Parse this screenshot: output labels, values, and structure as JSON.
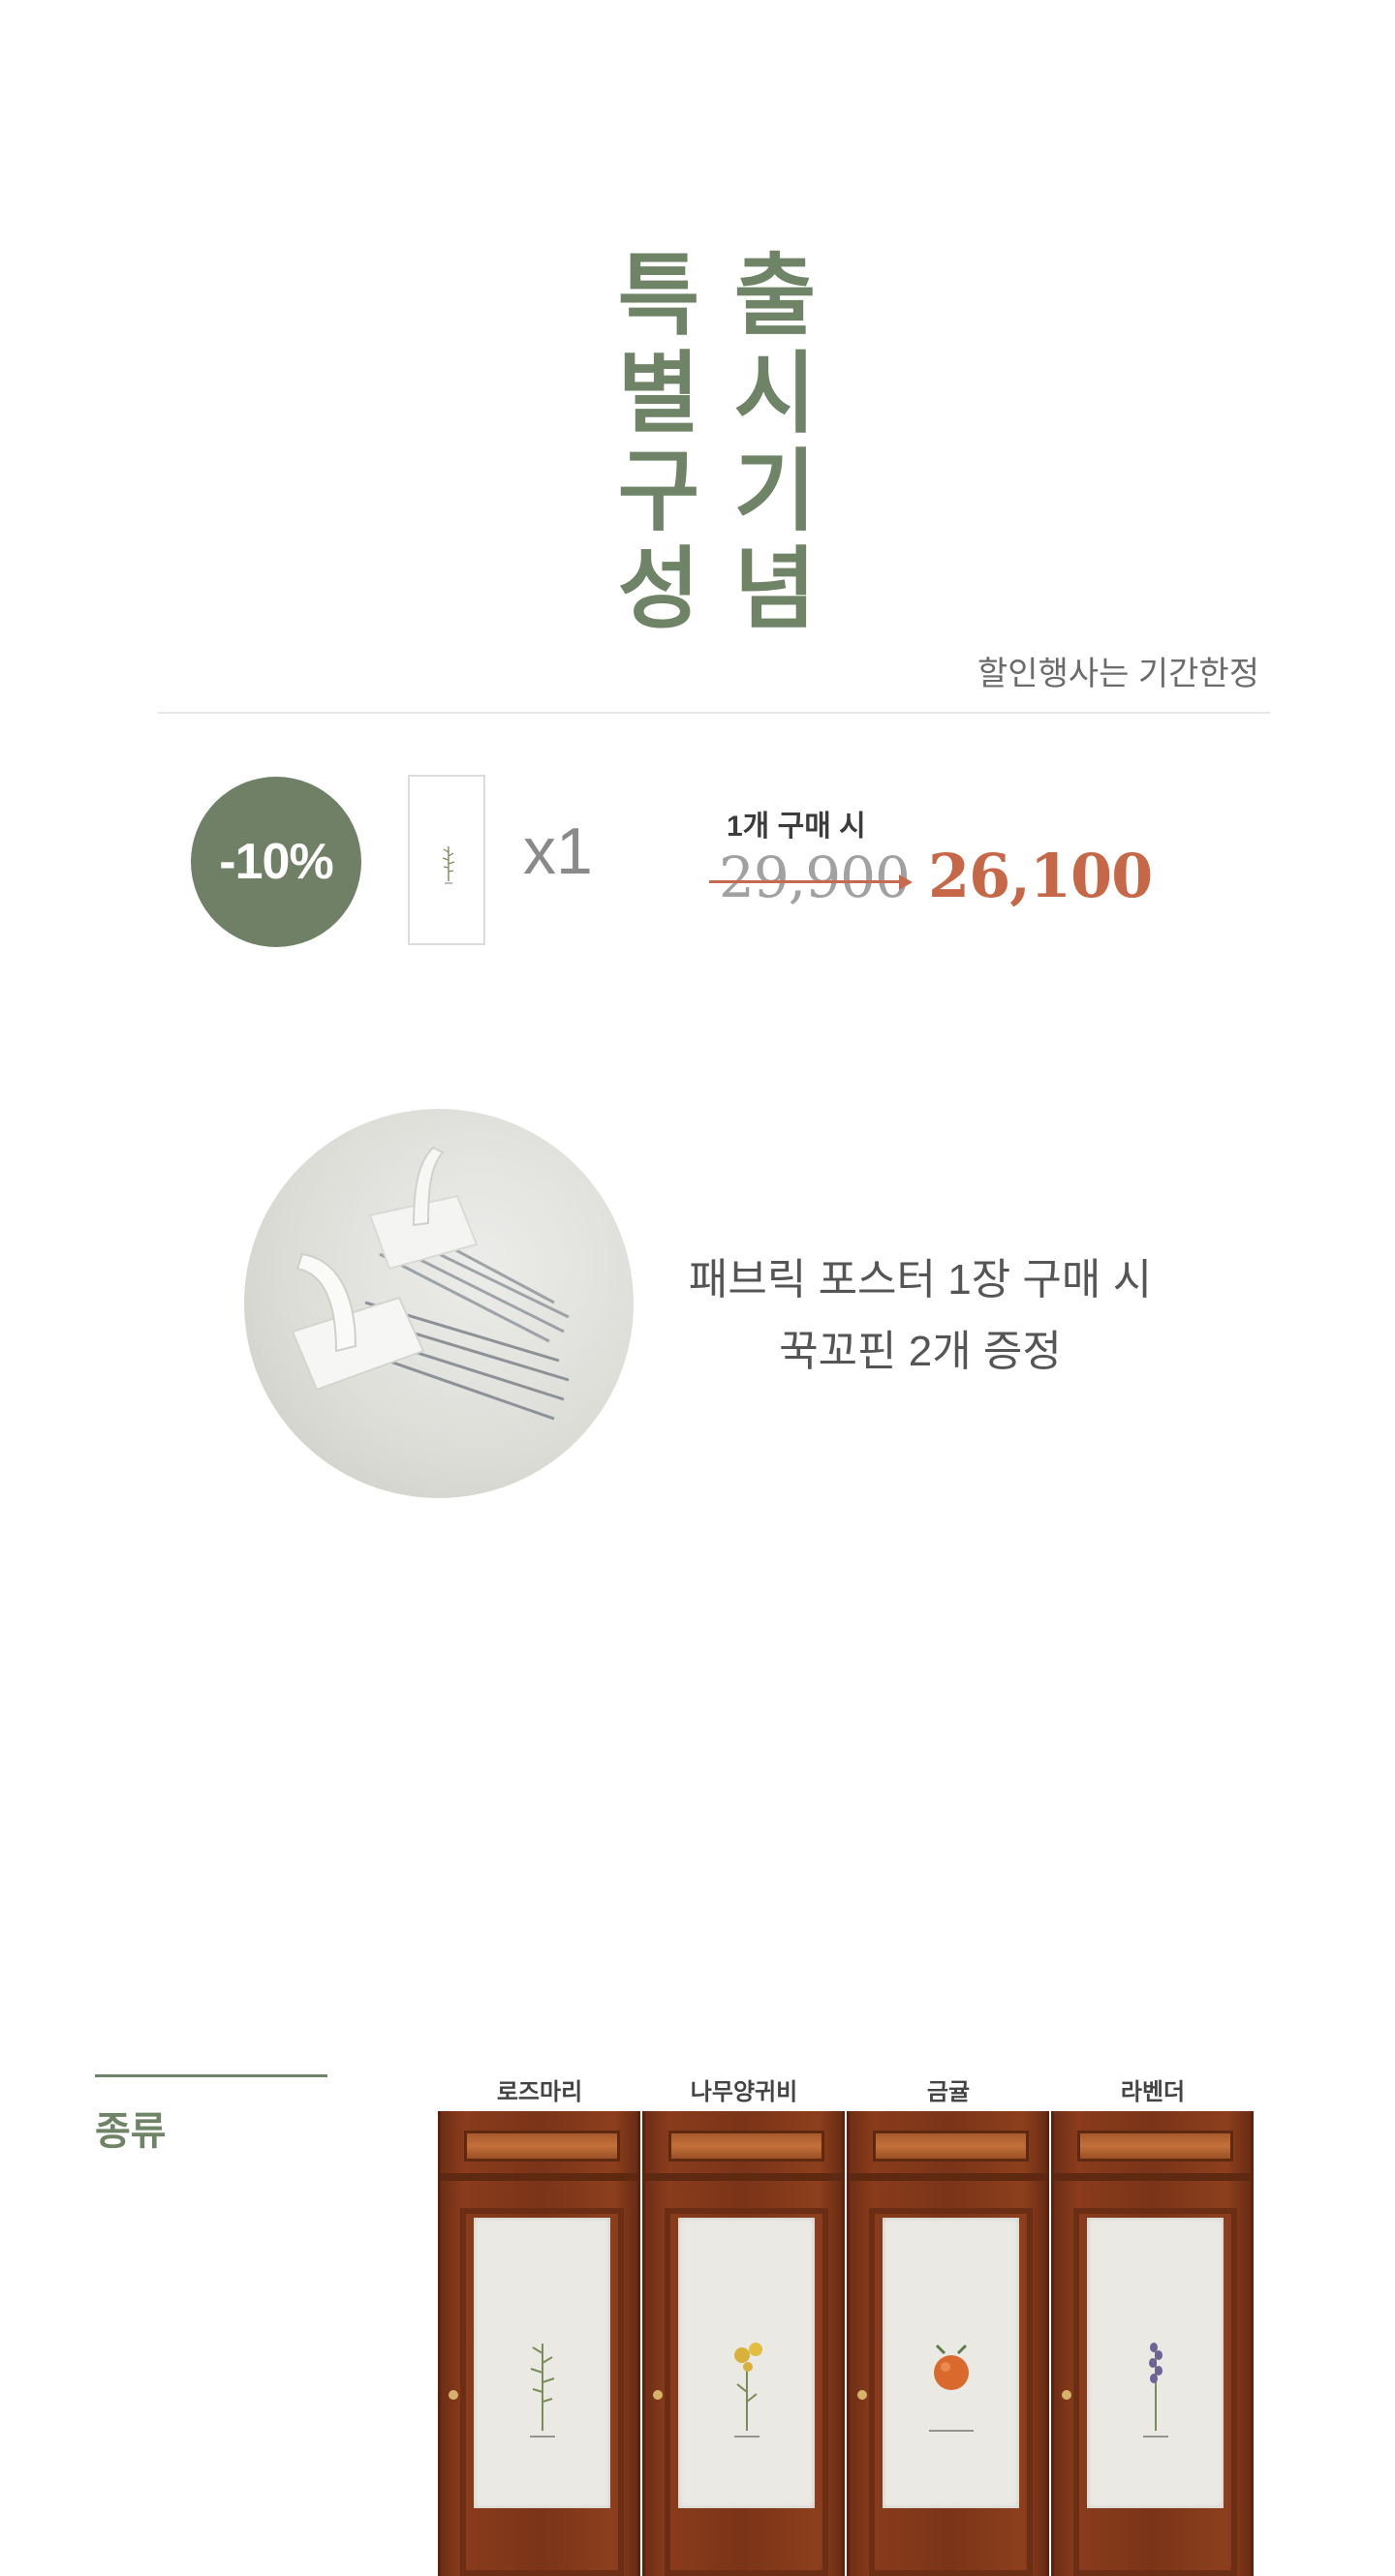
{
  "title": {
    "left_column": [
      "특",
      "별",
      "구",
      "성"
    ],
    "right_column": [
      "출",
      "시",
      "기",
      "념"
    ]
  },
  "period_note": "할인행사는 기간한정",
  "discount": {
    "badge": "-10%",
    "quantity": "x1",
    "buy_label": "1개 구매 시",
    "original_price": "29,900",
    "sale_price": "26,100",
    "colors": {
      "accent": "#6f8066",
      "price": "#c66747"
    }
  },
  "gift": {
    "line1": "패브릭 포스터 1장 구매 시",
    "line2": "꾹꼬핀 2개 증정"
  },
  "types": {
    "label": "종류",
    "items": [
      {
        "name": "로즈마리",
        "plant_color": "#7a8c5a"
      },
      {
        "name": "나무양귀비",
        "plant_color": "#d8b13a"
      },
      {
        "name": "금귤",
        "plant_color": "#d9692c"
      },
      {
        "name": "라벤더",
        "plant_color": "#6e6396"
      }
    ]
  }
}
